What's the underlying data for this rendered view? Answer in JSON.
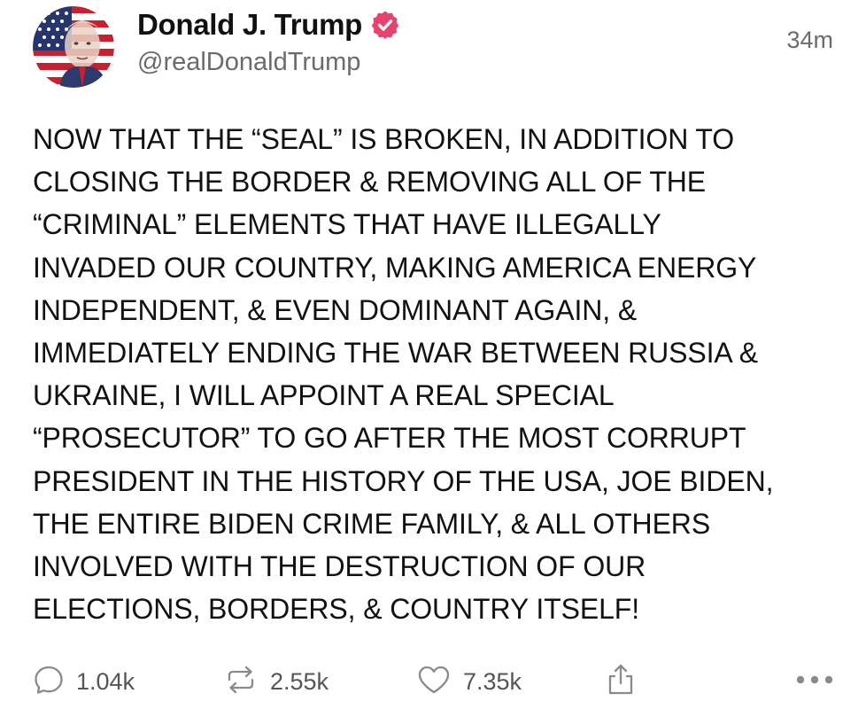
{
  "post": {
    "author": {
      "display_name": "Donald J. Trump",
      "handle": "@realDonaldTrump",
      "verified": true,
      "verified_color": "#e8426d"
    },
    "timestamp": "34m",
    "text": "NOW THAT THE “SEAL” IS BROKEN, IN ADDITION TO\nCLOSING THE BORDER & REMOVING ALL OF THE\n“CRIMINAL” ELEMENTS THAT HAVE ILLEGALLY\nINVADED OUR COUNTRY, MAKING AMERICA ENERGY\nINDEPENDENT, & EVEN DOMINANT AGAIN, &\nIMMEDIATELY ENDING THE WAR BETWEEN RUSSIA &\nUKRAINE, I WILL APPOINT A REAL SPECIAL\n“PROSECUTOR” TO GO AFTER THE MOST CORRUPT\nPRESIDENT IN THE HISTORY OF THE USA, JOE BIDEN,\nTHE ENTIRE BIDEN CRIME FAMILY, & ALL OTHERS\nINVOLVED WITH THE DESTRUCTION OF OUR\nELECTIONS, BORDERS, & COUNTRY ITSELF!",
    "actions": {
      "reply": {
        "icon": "reply-icon",
        "count": "1.04k"
      },
      "retruth": {
        "icon": "retruth-icon",
        "count": "2.55k"
      },
      "like": {
        "icon": "heart-icon",
        "count": "7.35k"
      },
      "share": {
        "icon": "share-icon"
      },
      "more": {
        "icon": "more-icon"
      }
    }
  },
  "colors": {
    "text": "#111111",
    "muted": "#6b6b6b",
    "icon": "#8a8a8a",
    "verified": "#e8426d"
  }
}
